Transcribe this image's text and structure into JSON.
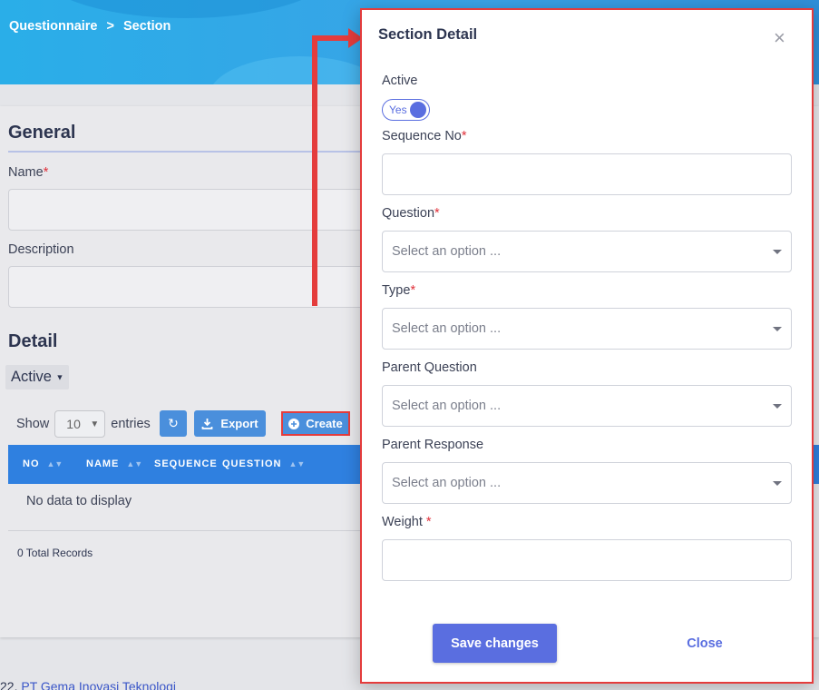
{
  "breadcrumb": {
    "item1": "Questionnaire",
    "separator": ">",
    "item2": "Section"
  },
  "general": {
    "title": "General",
    "name_label": "Name",
    "description_label": "Description"
  },
  "detail": {
    "title": "Detail",
    "active_filter": "Active",
    "show_label": "Show",
    "entries_value": "10",
    "entries_label": "entries",
    "export_label": "Export",
    "create_label": "Create",
    "columns": [
      "NO",
      "NAME",
      "SEQUENCE",
      "QUESTION"
    ],
    "no_data": "No data to display",
    "total_records": "0 Total Records"
  },
  "footer": {
    "prefix": "22",
    "company": "PT Gema Inovasi Teknologi"
  },
  "modal": {
    "title": "Section Detail",
    "close_icon": "×",
    "active_label": "Active",
    "toggle_value": "Yes",
    "sequence_label": "Sequence No",
    "question_label": "Question",
    "question_placeholder": "Select an option ...",
    "type_label": "Type",
    "type_placeholder": "Select an option ...",
    "parent_question_label": "Parent Question",
    "parent_question_placeholder": "Select an option ...",
    "parent_response_label": "Parent Response",
    "parent_response_placeholder": "Select an option ...",
    "weight_label": "Weight",
    "save_label": "Save changes",
    "close_label": "Close",
    "required_mark": "*"
  },
  "colors": {
    "accent": "#5a6ee0",
    "header_blue": "#2aaee8",
    "table_header": "#2f80e0",
    "button_blue": "#4a8fdc",
    "highlight_red": "#e43c3c"
  },
  "icons": {
    "refresh": "refresh-icon",
    "export": "download-icon",
    "create": "plus-circle-icon",
    "close": "close-icon",
    "dropdown": "chevron-down-icon",
    "sort": "sort-icon"
  }
}
